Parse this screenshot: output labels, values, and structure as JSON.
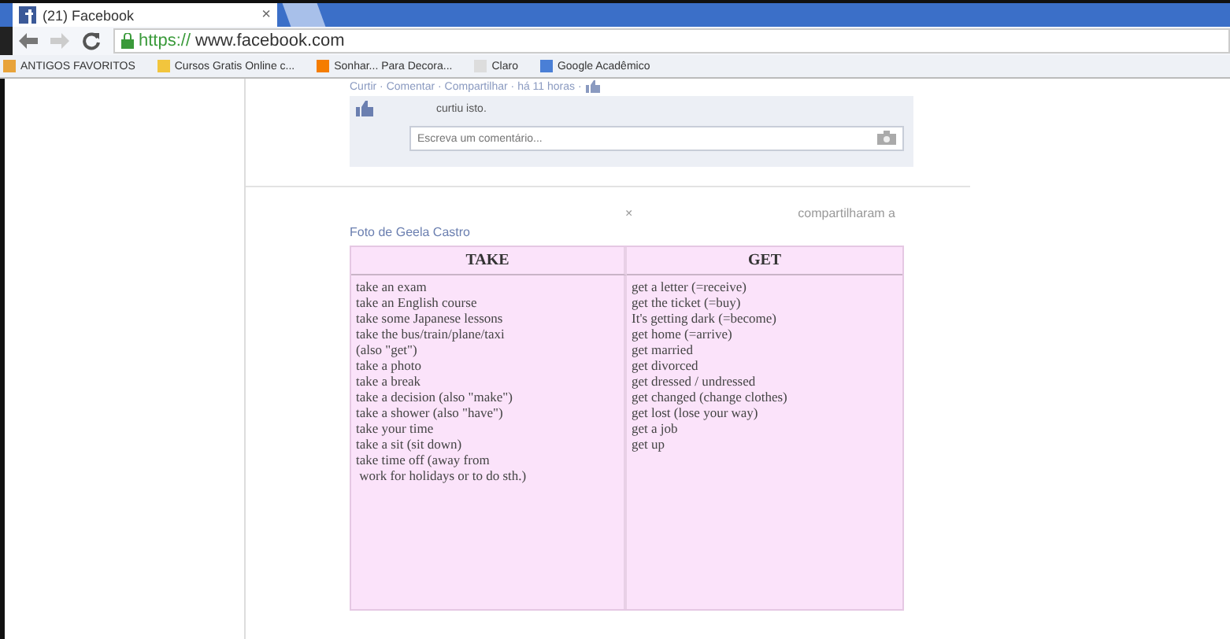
{
  "browser": {
    "tab_title": "(21) Facebook",
    "tab_close": "×",
    "url_scheme": "https://",
    "url_host": "www.facebook.com",
    "bookmarks": [
      {
        "label": "ANTIGOS FAVORITOS",
        "kind": "folder"
      },
      {
        "label": "Cursos Gratis Online c...",
        "kind": "star"
      },
      {
        "label": "Sonhar... Para Decora...",
        "kind": "blogger"
      },
      {
        "label": "Claro",
        "kind": "page"
      },
      {
        "label": "Google Acadêmico",
        "kind": "google"
      }
    ]
  },
  "post": {
    "actions": "Curtir · Comentar · Compartilhar · há 11 horas ·",
    "likes": "curtiu isto.",
    "comment": {
      "placeholder": "Escreva um comentário..."
    }
  },
  "share": {
    "close": "×",
    "text": "compartilharam a",
    "photo_by": "Foto de Geela Castro"
  },
  "table": {
    "columns": [
      "TAKE",
      "GET"
    ],
    "take": [
      "take an exam",
      "take an English course",
      "take some Japanese lessons",
      "take the bus/train/plane/taxi",
      "(also \"get\")",
      "take a photo",
      "take a break",
      "take a decision (also \"make\")",
      "take a shower (also \"have\")",
      "take your time",
      "take a sit (sit down)",
      "take time off (away from",
      " work for holidays or to do sth.)"
    ],
    "get": [
      "get a letter (=receive)",
      "get the ticket (=buy)",
      "It's getting dark (=become)",
      "get home (=arrive)",
      "get married",
      "get divorced",
      "get dressed / undressed",
      "get changed (change clothes)",
      "get lost (lose your way)",
      "get a job",
      "get up"
    ]
  }
}
